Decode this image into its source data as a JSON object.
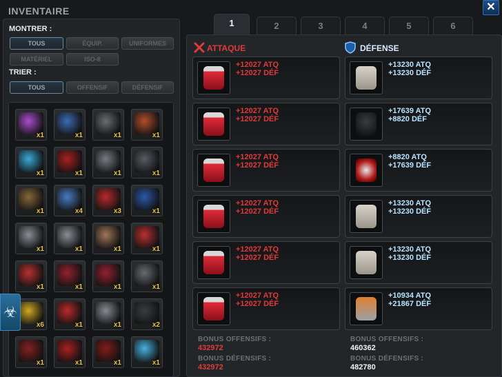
{
  "title": "INVENTAIRE",
  "close_label": "✕",
  "filters": {
    "show_label": "MONTRER :",
    "show_buttons": [
      "TOUS",
      "ÉQUIP.",
      "UNIFORMES",
      "MATÉRIEL",
      "ISO-8"
    ],
    "sort_label": "TRIER :",
    "sort_buttons": [
      "TOUS",
      "OFFENSIF",
      "DÉFENSIF"
    ]
  },
  "inventory": [
    {
      "icon": "blaster-icon",
      "count": "x1",
      "color": "#b04fd6"
    },
    {
      "icon": "gauntlet-icon",
      "count": "x1",
      "color": "#3d6fb8"
    },
    {
      "icon": "revolver-icon",
      "count": "x1",
      "color": "#6c7278"
    },
    {
      "icon": "rifle-icon",
      "count": "x1",
      "color": "#b8502a"
    },
    {
      "icon": "energy-gauntlet-icon",
      "count": "x1",
      "color": "#3ab0e0"
    },
    {
      "icon": "pistol-icon",
      "count": "x1",
      "color": "#b02020"
    },
    {
      "icon": "sniper-rifle-icon",
      "count": "x1",
      "color": "#7a8088"
    },
    {
      "icon": "dagger-icon",
      "count": "x1",
      "color": "#595f66"
    },
    {
      "icon": "spear-icon",
      "count": "x1",
      "color": "#8a6a3a"
    },
    {
      "icon": "spotted-glove-icon",
      "count": "x4",
      "color": "#4a80c8"
    },
    {
      "icon": "beetle-icon",
      "count": "x3",
      "color": "#c02a2a"
    },
    {
      "icon": "shield-device-icon",
      "count": "x1",
      "color": "#2a5ab0"
    },
    {
      "icon": "steel-fist-icon",
      "count": "x1",
      "color": "#8c939a"
    },
    {
      "icon": "steel-fist-icon",
      "count": "x1",
      "color": "#8c939a"
    },
    {
      "icon": "fist-icon",
      "count": "x1",
      "color": "#a67a5a"
    },
    {
      "icon": "red-bracelet-icon",
      "count": "x1",
      "color": "#c03030"
    },
    {
      "icon": "red-bracelet-icon",
      "count": "x1",
      "color": "#c03030"
    },
    {
      "icon": "red-rifle-icon",
      "count": "x1",
      "color": "#9a2030"
    },
    {
      "icon": "red-rifle-icon",
      "count": "x1",
      "color": "#9a2030"
    },
    {
      "icon": "raygun-icon",
      "count": "x1",
      "color": "#6a6f76"
    },
    {
      "icon": "goggles-icon",
      "count": "x6",
      "color": "#d8b020"
    },
    {
      "icon": "red-shield-icon",
      "count": "x1",
      "color": "#c02a2a"
    },
    {
      "icon": "plasma-gun-icon",
      "count": "x1",
      "color": "#8a9098"
    },
    {
      "icon": "fedora-icon",
      "count": "x2",
      "color": "#3a3d40"
    },
    {
      "icon": "armored-glove-icon",
      "count": "x1",
      "color": "#8a2020"
    },
    {
      "icon": "red-claw-icon",
      "count": "x1",
      "color": "#b02020"
    },
    {
      "icon": "sword-icon",
      "count": "x1",
      "color": "#8a1a1a"
    },
    {
      "icon": "ice-sword-icon",
      "count": "x1",
      "color": "#4ab8e8"
    }
  ],
  "tabs": [
    "1",
    "2",
    "3",
    "4",
    "5",
    "6"
  ],
  "attack": {
    "header": "ATTAQUE",
    "color": "#e03a3a",
    "items": [
      {
        "icon": "red-vial-icon",
        "atq": "+12027 ATQ",
        "def": "+12027 DÉF"
      },
      {
        "icon": "red-vial-icon",
        "atq": "+12027 ATQ",
        "def": "+12027 DÉF"
      },
      {
        "icon": "red-vial-icon",
        "atq": "+12027 ATQ",
        "def": "+12027 DÉF"
      },
      {
        "icon": "red-vial-icon",
        "atq": "+12027 ATQ",
        "def": "+12027 DÉF"
      },
      {
        "icon": "red-vial-icon",
        "atq": "+12027 ATQ",
        "def": "+12027 DÉF"
      },
      {
        "icon": "red-vial-icon",
        "atq": "+12027 ATQ",
        "def": "+12027 DÉF"
      }
    ]
  },
  "defense": {
    "header": "DÉFENSE",
    "color": "#b8e4ff",
    "items": [
      {
        "icon": "newspaper-icon",
        "atq": "+13230 ATQ",
        "def": "+13230 DÉF"
      },
      {
        "icon": "fedora-icon",
        "atq": "+17639 ATQ",
        "def": "+8820 DÉF"
      },
      {
        "icon": "web-emblem-icon",
        "atq": "+8820 ATQ",
        "def": "+17639 DÉF"
      },
      {
        "icon": "newspaper-icon",
        "atq": "+13230 ATQ",
        "def": "+13230 DÉF"
      },
      {
        "icon": "newspaper-icon",
        "atq": "+13230 ATQ",
        "def": "+13230 DÉF"
      },
      {
        "icon": "power-fist-icon",
        "atq": "+10934 ATQ",
        "def": "+21867 DÉF"
      }
    ]
  },
  "bonus": {
    "attack": {
      "off_label": "BONUS OFFENSIFS :",
      "off_value": "432972",
      "def_label": "BONUS DÉFENSIFS :",
      "def_value": "432972"
    },
    "defense": {
      "off_label": "BONUS OFFENSIFS :",
      "off_value": "460362",
      "def_label": "BONUS DÉFENSIFS :",
      "def_value": "482780"
    }
  }
}
